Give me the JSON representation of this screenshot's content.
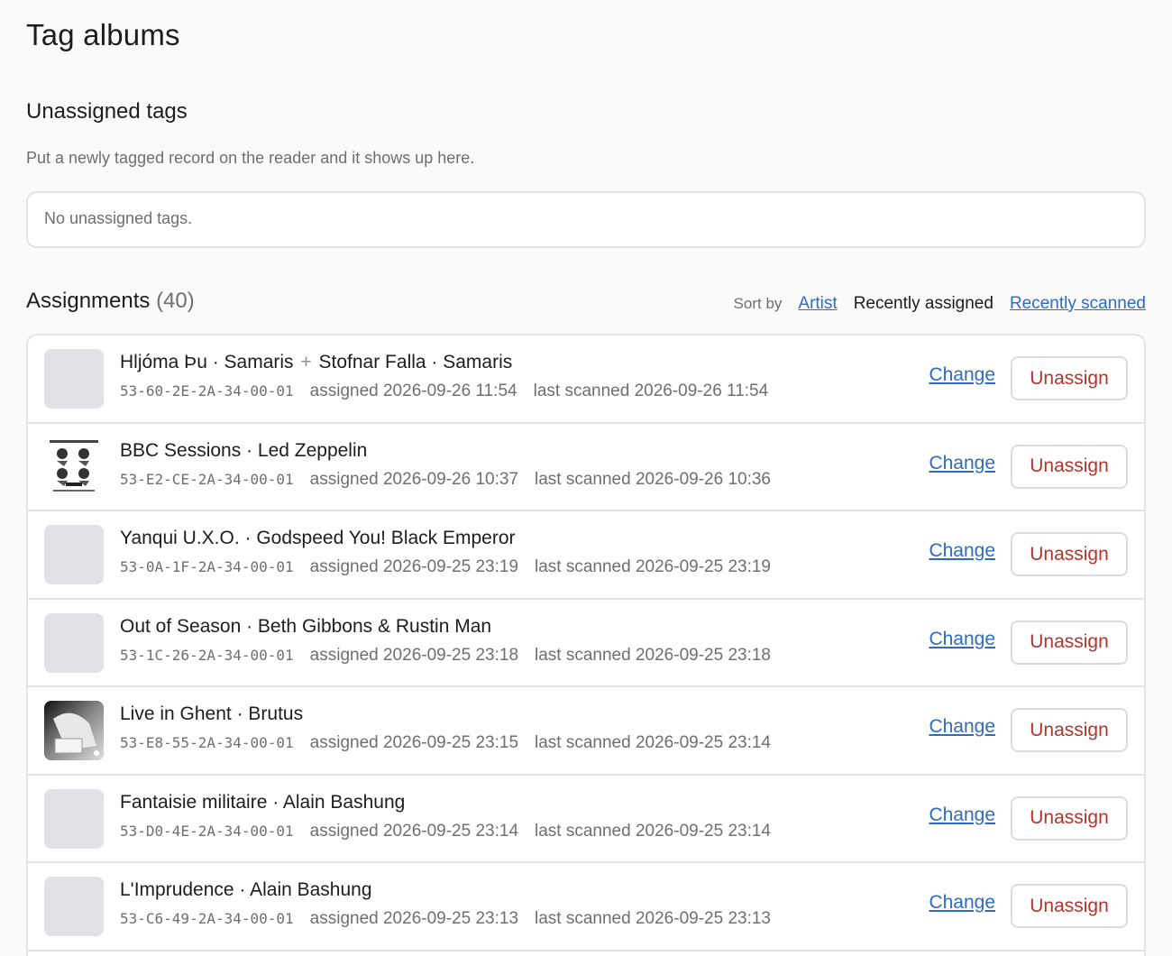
{
  "page": {
    "title": "Tag albums"
  },
  "unassigned": {
    "title": "Unassigned tags",
    "hint": "Put a newly tagged record on the reader and it shows up here.",
    "empty": "No unassigned tags."
  },
  "assignments": {
    "title": "Assignments",
    "count": "(40)",
    "sort": {
      "label": "Sort by",
      "options": [
        "Artist",
        "Recently assigned",
        "Recently scanned"
      ],
      "active": "Recently assigned"
    },
    "change_label": "Change",
    "unassign_label": "Unassign",
    "rows": [
      {
        "title_a": "Hljóma Þu · Samaris",
        "plus": "+",
        "title_b": "Stofnar Falla · Samaris",
        "tag": "53-60-2E-2A-34-00-01",
        "assigned": "assigned 2026-09-26 11:54",
        "scanned": "last scanned 2026-09-26 11:54",
        "art": "placeholder"
      },
      {
        "title_a": "BBC Sessions · Led Zeppelin",
        "plus": "",
        "title_b": "",
        "tag": "53-E2-CE-2A-34-00-01",
        "assigned": "assigned 2026-09-26 10:37",
        "scanned": "last scanned 2026-09-26 10:36",
        "art": "zeppelin"
      },
      {
        "title_a": "Yanqui U.X.O. · Godspeed You! Black Emperor",
        "plus": "",
        "title_b": "",
        "tag": "53-0A-1F-2A-34-00-01",
        "assigned": "assigned 2026-09-25 23:19",
        "scanned": "last scanned 2026-09-25 23:19",
        "art": "placeholder"
      },
      {
        "title_a": "Out of Season · Beth Gibbons & Rustin Man",
        "plus": "",
        "title_b": "",
        "tag": "53-1C-26-2A-34-00-01",
        "assigned": "assigned 2026-09-25 23:18",
        "scanned": "last scanned 2026-09-25 23:18",
        "art": "placeholder"
      },
      {
        "title_a": "Live in Ghent · Brutus",
        "plus": "",
        "title_b": "",
        "tag": "53-E8-55-2A-34-00-01",
        "assigned": "assigned 2026-09-25 23:15",
        "scanned": "last scanned 2026-09-25 23:14",
        "art": "brutus"
      },
      {
        "title_a": "Fantaisie militaire · Alain Bashung",
        "plus": "",
        "title_b": "",
        "tag": "53-D0-4E-2A-34-00-01",
        "assigned": "assigned 2026-09-25 23:14",
        "scanned": "last scanned 2026-09-25 23:14",
        "art": "placeholder"
      },
      {
        "title_a": "L'Imprudence · Alain Bashung",
        "plus": "",
        "title_b": "",
        "tag": "53-C6-49-2A-34-00-01",
        "assigned": "assigned 2026-09-25 23:13",
        "scanned": "last scanned 2026-09-25 23:13",
        "art": "placeholder"
      }
    ]
  }
}
